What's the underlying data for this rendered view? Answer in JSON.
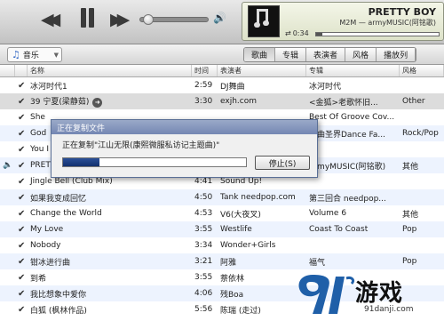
{
  "lcd": {
    "title": "PRETTY BOY",
    "subtitle": "M2M — armyMUSIC(阿铭歌)",
    "elapsed": "0:34",
    "progress": 0.05
  },
  "volume": {
    "level": 0.05
  },
  "source": {
    "label": "音乐"
  },
  "view_tabs": [
    "歌曲",
    "专辑",
    "表演者",
    "风格",
    "播放列"
  ],
  "active_tab": 0,
  "columns": [
    "名称",
    "时间",
    "表演者",
    "专辑",
    "风格"
  ],
  "rows": [
    {
      "check": "✔",
      "name": "冰河时代1",
      "time": "2:59",
      "artist": "DJ舞曲",
      "album": "冰河时代",
      "genre": ""
    },
    {
      "check": "✔",
      "name": "39 宁夏(梁静茹)",
      "time": "3:30",
      "artist": "exjh.com",
      "album": "<金狐>老歌怀旧...",
      "genre": "Other",
      "selected": true
    },
    {
      "check": "✔",
      "name": "She",
      "time": "",
      "artist": "",
      "album": "Best Of Groove Cov...",
      "genre": ""
    },
    {
      "check": "✔",
      "name": "God",
      "time": "",
      "artist": "",
      "album": "舞曲圣界Dance Fa...",
      "genre": "Rock/Pop"
    },
    {
      "check": "✔",
      "name": "You I",
      "time": "",
      "artist": "",
      "album": "",
      "genre": ""
    },
    {
      "check": "✔",
      "name": "PRET",
      "time": "",
      "artist": "",
      "album": "armyMUSIC(阿铭歌)",
      "genre": "其他",
      "playing": true
    },
    {
      "check": "✔",
      "name": "Jingle Bell (Club Mix)",
      "time": "4:41",
      "artist": "Sound Up!",
      "album": "",
      "genre": ""
    },
    {
      "check": "✔",
      "name": "如果我变成回忆",
      "time": "4:50",
      "artist": "Tank needpop.com",
      "album": "第三回合 needpop...",
      "genre": ""
    },
    {
      "check": "✔",
      "name": "Change the World",
      "time": "4:53",
      "artist": "V6(大夜叉)",
      "album": "Volume 6",
      "genre": "其他"
    },
    {
      "check": "✔",
      "name": "My Love",
      "time": "3:55",
      "artist": "Westlife",
      "album": "Coast To Coast",
      "genre": "Pop"
    },
    {
      "check": "✔",
      "name": "Nobody",
      "time": "3:34",
      "artist": "Wonder+Girls",
      "album": "",
      "genre": ""
    },
    {
      "check": "✔",
      "name": "钳冰进行曲",
      "time": "3:21",
      "artist": "阿雅",
      "album": "福气",
      "genre": "Pop"
    },
    {
      "check": "✔",
      "name": "到希",
      "time": "3:55",
      "artist": "萘依林",
      "album": "",
      "genre": ""
    },
    {
      "check": "✔",
      "name": "我比想象中爱你",
      "time": "4:06",
      "artist": "残Boa",
      "album": "",
      "genre": ""
    },
    {
      "check": "✔",
      "name": "白狐 (枫林作品)",
      "time": "5:56",
      "artist": "陈瑞 (走过)",
      "album": "",
      "genre": ""
    }
  ],
  "dialog": {
    "title": "正在复制文件",
    "message": "正在复制\"江山无限(康熙微服私访记主题曲)\"",
    "progress": 0.2,
    "stop_label": "停止(S)"
  },
  "watermark": {
    "brand": "游戏",
    "url": "91danji.com"
  },
  "colors": {
    "dialog_title": "#7487b3",
    "progress_fill": "#1b3c80",
    "row_alt": "#edf3fe",
    "logo_accent": "#1f5fa8"
  }
}
